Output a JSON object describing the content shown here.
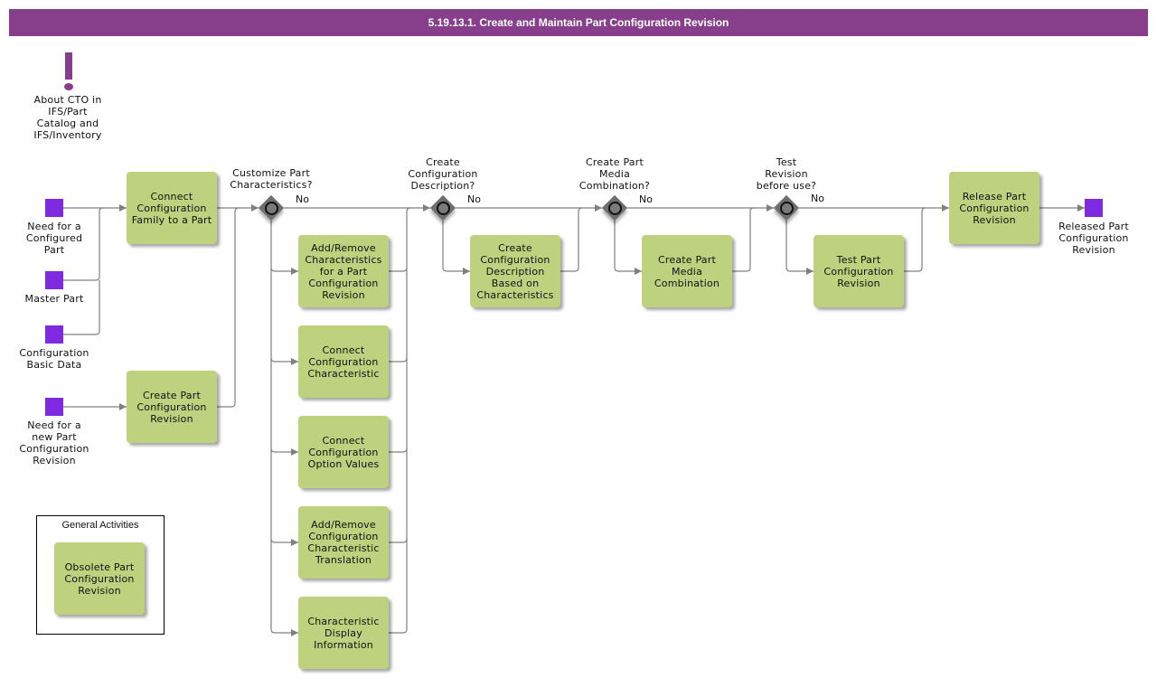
{
  "header": {
    "title": "5.19.13.1. Create and Maintain Part Configuration Revision"
  },
  "colors": {
    "header_bg": "#873e8b",
    "task_fill": "#bdd17e",
    "event_fill": "#7d2ae0",
    "gateway_fill": "#6e6e6e",
    "connector": "#808080"
  },
  "info": {
    "icon": "exclamation-icon",
    "label": "About CTO in\nIFS/Part\nCatalog and\nIFS/Inventory"
  },
  "events": {
    "need_configured_part": "Need for a\nConfigured\nPart",
    "master_part": "Master Part",
    "config_basic_data": "Configuration\nBasic Data",
    "need_new_revision": "Need for a\nnew Part\nConfiguration\nRevision",
    "released_revision": "Released Part\nConfiguration\nRevision"
  },
  "tasks": {
    "connect_family": "Connect Configuration Family to a Part",
    "create_revision": "Create Part Configuration Revision",
    "add_remove_characteristics": "Add/Remove Characteristics for a Part Configuration Revision",
    "connect_characteristic": "Connect Configuration Characteristic",
    "connect_option_values": "Connect Configuration Option Values",
    "add_remove_translation": "Add/Remove Configuration Characteristic Translation",
    "display_information": "Characteristic Display Information",
    "create_description": "Create Configuration Description Based on Characteristics",
    "create_media": "Create Part Media Combination",
    "test_revision": "Test Part Configuration Revision",
    "release_revision": "Release Part Configuration Revision",
    "obsolete_revision": "Obsolete Part Configuration Revision"
  },
  "gateways": {
    "customize": "Customize Part\nCharacteristics?",
    "description": "Create\nConfiguration\nDescription?",
    "media": "Create Part\nMedia\nCombination?",
    "test": "Test\nRevision\nbefore use?"
  },
  "branch_label": "No",
  "general_activities": {
    "title": "General Activities"
  }
}
